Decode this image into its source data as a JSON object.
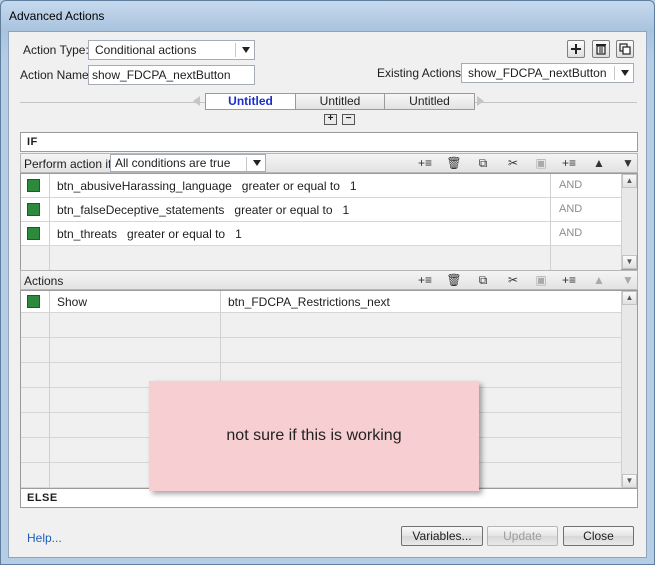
{
  "window": {
    "title": "Advanced Actions"
  },
  "header": {
    "action_type_label": "Action Type:",
    "action_type_value": "Conditional actions",
    "action_name_label": "Action Name:",
    "action_name_value": "show_FDCPA_nextButton",
    "existing_actions_label": "Existing Actions:",
    "existing_actions_value": "show_FDCPA_nextButton",
    "icons": [
      "add-icon",
      "trash-icon",
      "duplicate-icon"
    ]
  },
  "tabs": [
    {
      "label": "Untitled",
      "active": true
    },
    {
      "label": "Untitled",
      "active": false
    },
    {
      "label": "Untitled",
      "active": false
    }
  ],
  "tab_buttons": {
    "add": "+",
    "remove": "−"
  },
  "if_section": {
    "header": "IF",
    "perform_label": "Perform action if:",
    "perform_value": "All conditions are true",
    "conditions": [
      {
        "text": "btn_abusiveHarassing_language   greater or equal to   1",
        "conjunction": "AND"
      },
      {
        "text": "btn_falseDeceptive_statements   greater or equal to   1",
        "conjunction": "AND"
      },
      {
        "text": "btn_threats   greater or equal to   1",
        "conjunction": "AND"
      }
    ]
  },
  "actions_section": {
    "label": "Actions",
    "rows": [
      {
        "action": "Show",
        "target": "btn_FDCPA_Restrictions_next"
      }
    ]
  },
  "else_label": "ELSE",
  "note": "not sure if this is working",
  "footer": {
    "help": "Help...",
    "variables": "Variables...",
    "update": "Update",
    "close": "Close"
  },
  "colors": {
    "condition_marker": "#2c8a3a",
    "note_bg": "#f7cfd2",
    "active_tab_text": "#1a2ec8"
  }
}
